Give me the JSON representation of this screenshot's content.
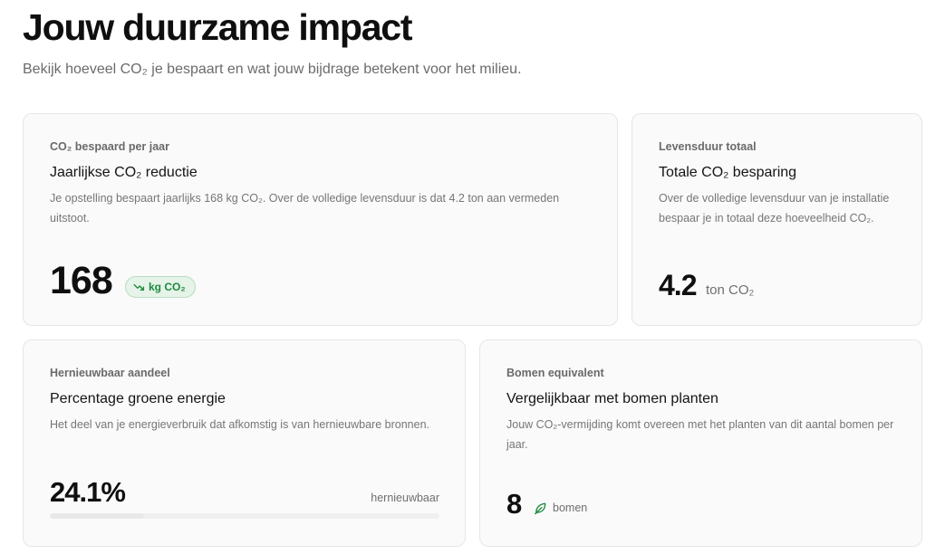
{
  "header": {
    "title": "Jouw duurzame impact",
    "subtitle": "Bekijk hoeveel CO₂ je bespaart en wat jouw bijdrage betekent voor het milieu."
  },
  "cards": {
    "annual": {
      "eyebrow": "CO₂ bespaard per jaar",
      "title": "Jaarlijkse CO₂ reductie",
      "description": "Je opstelling bespaart jaarlijks 168 kg CO₂. Over de volledige levensduur is dat 4.2 ton aan vermeden uitstoot.",
      "value": "168",
      "unit": "kg CO₂",
      "unit_icon": "trending-down-icon"
    },
    "total": {
      "eyebrow": "Levensduur totaal",
      "title": "Totale CO₂ besparing",
      "description": "Over de volledige levensduur van je installatie bespaar je in totaal deze hoeveelheid CO₂.",
      "value": "4.2",
      "unit": "ton CO₂"
    },
    "green": {
      "eyebrow": "Hernieuwbaar aandeel",
      "title": "Percentage groene energie",
      "description": "Het deel van je energieverbruik dat afkomstig is van hernieuwbare bronnen.",
      "value": "24.1%",
      "side_label": "hernieuwbaar",
      "progress_fraction": 0.241
    },
    "trees": {
      "eyebrow": "Bomen equivalent",
      "title": "Vergelijkbaar met bomen planten",
      "description": "Jouw CO₂-vermijding komt overeen met het planten van dit aantal bomen per jaar.",
      "value": "8",
      "unit": "bomen",
      "unit_icon": "leaf-icon"
    }
  },
  "colors": {
    "accent_green": "#1f8a3e",
    "pill_background": "#e5f3e8",
    "card_background": "#fafafa",
    "card_border": "#e6e6e6",
    "muted_text": "#767676"
  }
}
